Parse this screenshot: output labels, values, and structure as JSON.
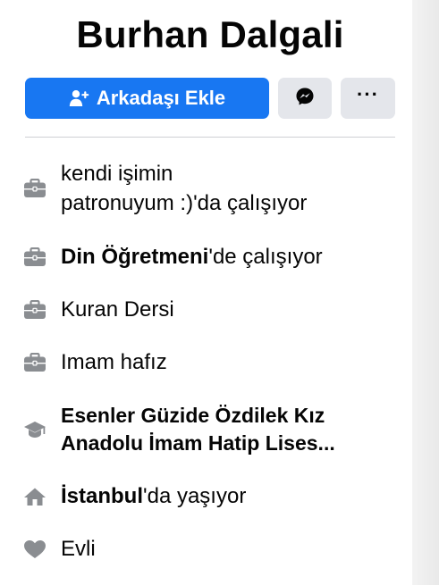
{
  "profile": {
    "name": "Burhan Dalgali"
  },
  "actions": {
    "add_friend_label": "Arkadaşı Ekle",
    "more_label": "···"
  },
  "intro": {
    "work1_line1": "kendi işimin",
    "work1_line2": "patronuyum :)'da çalışıyor",
    "work2_name": "Din Öğretmeni",
    "work2_suffix": "'de çalışıyor",
    "work3": "Kuran Dersi",
    "work4": "Imam hafız",
    "education_line1": "Esenler Güzide Özdilek Kız",
    "education_line2": "Anadolu İmam Hatip Lises...",
    "home_city": "İstanbul",
    "home_suffix": "'da yaşıyor",
    "relationship": "Evli"
  },
  "icons": {
    "add_friend": "user-plus-icon",
    "messenger": "messenger-icon",
    "work": "briefcase-icon",
    "education": "graduation-cap-icon",
    "home": "home-icon",
    "relationship": "heart-icon"
  },
  "colors": {
    "primary": "#1877f2",
    "secondary_button": "#e4e6eb",
    "icon_gray": "#8a8d91",
    "text": "#050505"
  }
}
